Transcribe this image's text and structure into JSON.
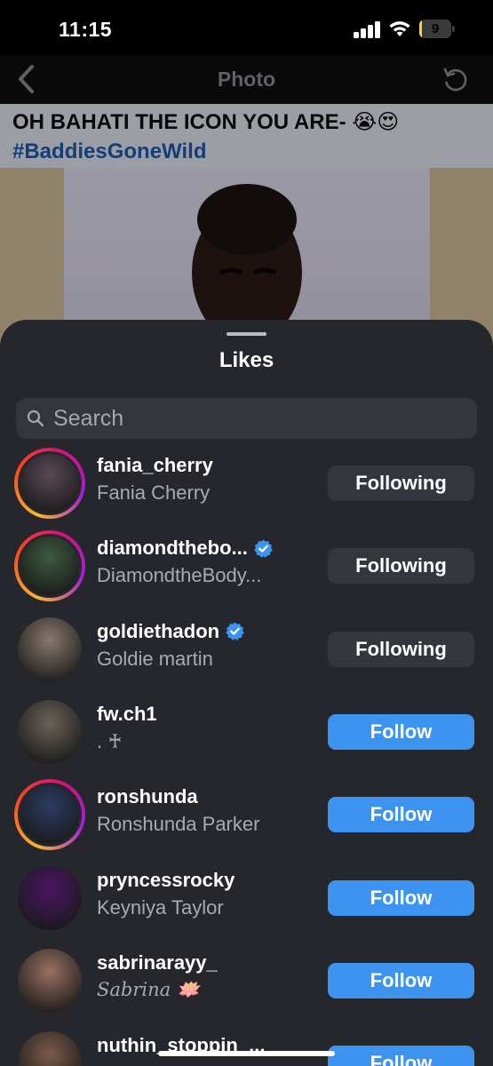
{
  "status_bar": {
    "time": "11:15",
    "battery_level": "9",
    "battery_fraction": 0.09
  },
  "nav": {
    "title": "Photo",
    "back_icon": "chevron-left-icon",
    "refresh_icon": "refresh-icon"
  },
  "photo": {
    "caption_line1": "OH BAHATI THE ICON YOU ARE- 😭😍",
    "caption_line2": "#BaddiesGoneWild"
  },
  "sheet": {
    "title": "Likes",
    "search": {
      "placeholder": "Search",
      "value": ""
    },
    "users": [
      {
        "username": "fania_cherry",
        "name": "Fania Cherry",
        "verified": false,
        "button": "Following",
        "story": true,
        "avatar_color": "#5a4a55"
      },
      {
        "username": "diamondthebo...",
        "name": "DiamondtheBody...",
        "verified": true,
        "button": "Following",
        "story": true,
        "avatar_color": "#3e5a3f"
      },
      {
        "username": "goldiethadon",
        "name": "Goldie martin",
        "verified": true,
        "button": "Following",
        "story": false,
        "avatar_color": "#8a7a70"
      },
      {
        "username": "fw.ch1",
        "name": ". ♰",
        "verified": false,
        "button": "Follow",
        "story": false,
        "avatar_color": "#6a6258"
      },
      {
        "username": "ronshunda",
        "name": "Ronshunda Parker",
        "verified": false,
        "button": "Follow",
        "story": true,
        "avatar_color": "#2b3c63"
      },
      {
        "username": "pryncessrocky",
        "name": "Keyniya Taylor",
        "verified": false,
        "button": "Follow",
        "story": false,
        "avatar_color": "#4a1563"
      },
      {
        "username": "sabrinarayy_",
        "name": "Sabrina 🪷",
        "verified": false,
        "button": "Follow",
        "story": false,
        "avatar_color": "#9a7060"
      },
      {
        "username": "nuthin_stoppin_...",
        "name": "",
        "verified": false,
        "button": "Follow",
        "story": false,
        "avatar_color": "#7a5a4a"
      }
    ]
  },
  "colors": {
    "follow_blue": "#3c93f0",
    "verified_blue": "#3c93f0",
    "sheet_bg": "#25272c"
  }
}
